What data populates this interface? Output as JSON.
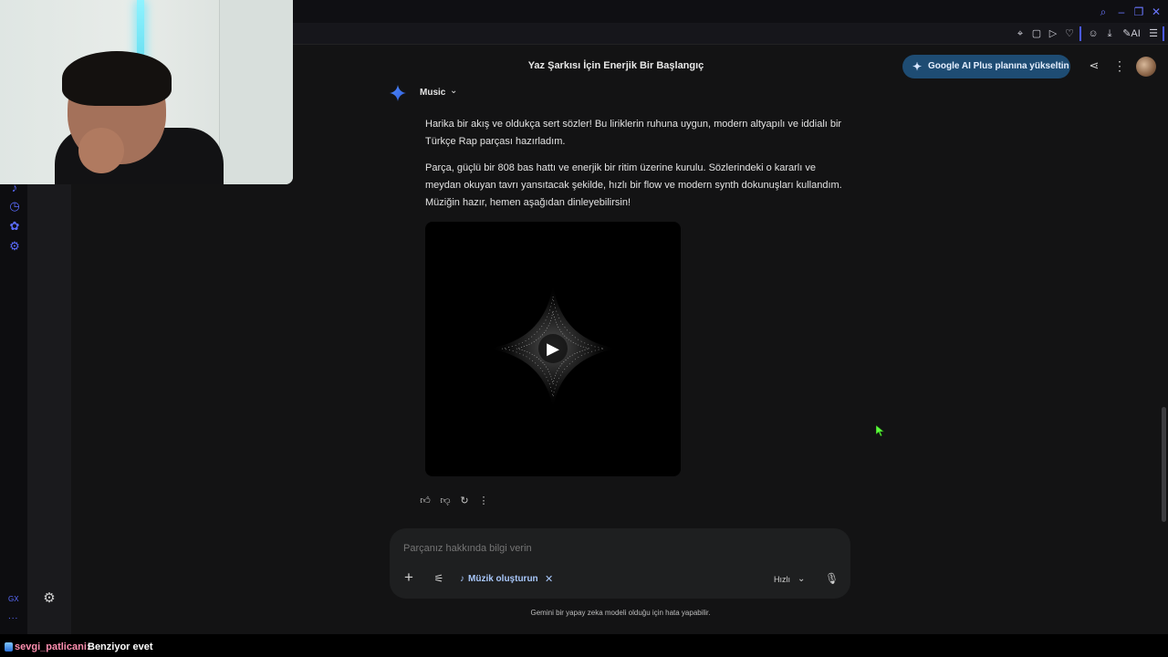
{
  "browser": {
    "window_controls": [
      "search-icon",
      "minimize-icon",
      "restore-icon",
      "close-icon"
    ],
    "toolbar_icons": [
      "pin-icon",
      "snapshot-icon",
      "play-icon",
      "heart-icon",
      "account-icon",
      "download-icon",
      "aria-ai-icon",
      "menu-icon"
    ],
    "ai_label": "AI",
    "accent_color": "#5b6cff"
  },
  "sidebar": {
    "rail_icons": [
      "bell-icon",
      "history-icon",
      "extensions-icon",
      "settings-icon"
    ],
    "gx_label": "GX",
    "more_label": "...",
    "bottom_icon": "settings-icon"
  },
  "header": {
    "title": "Yaz Şarkısı İçin Enerjik Bir Başlangıç",
    "upgrade_label": "Google AI Plus planına yükseltin",
    "upgrade_color": "#1e4c73"
  },
  "gem": {
    "name": "Music"
  },
  "response": {
    "paragraph1": "Harika bir akış ve oldukça sert sözler! Bu liriklerin ruhuna uygun, modern altyapılı ve iddialı bir Türkçe Rap parçası hazırladım.",
    "paragraph2": "Parça, güçlü bir 808 bas hattı ve enerjik bir ritim üzerine kurulu. Sözlerindeki o kararlı ve meydan okuyan tavrı yansıtacak şekilde, hızlı bir flow ve modern synth dokunuşları kullandım. Müziğin hazır, hemen aşağıdan dinleyebilirsin!",
    "actions": [
      "thumbs-up-icon",
      "thumbs-down-icon",
      "redo-icon",
      "more-icon"
    ]
  },
  "composer": {
    "placeholder": "Parçanız hakkında bilgi verin",
    "chip_label": "Müzik oluşturun",
    "model_label": "Hızlı"
  },
  "footer": {
    "disclaimer": "Gemini bir yapay zeka modeli olduğu için hata yapabilir."
  },
  "stream_chat": {
    "username": "sevgi_patlicani:",
    "message": "Benziyor evet"
  }
}
